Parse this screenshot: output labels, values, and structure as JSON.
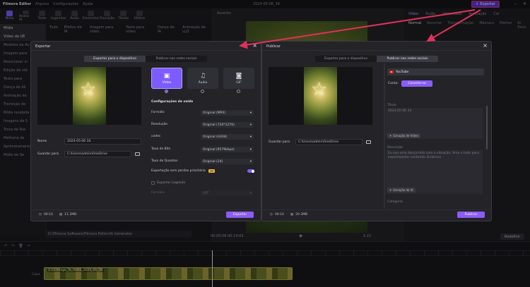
{
  "app": {
    "name": "Filmora Editor",
    "menus": [
      "Arquivo",
      "Configurações",
      "Ajuda"
    ],
    "doc_title": "2024-05-06_34",
    "export_button": "Exportar"
  },
  "toolbar": {
    "tools": [
      "Mídia",
      "Avatar AI",
      "Texto",
      "Legendas",
      "Áudio",
      "Elementos",
      "Transição",
      "Títulos",
      "Efeitos"
    ]
  },
  "left_panel": {
    "items": [
      "Mídia",
      "Vídeo da UE",
      "Modelos da Au",
      "Imagem para",
      "Reescrever vi",
      "Edição de vid",
      "Texto para",
      "Dança de Ali",
      "Animação de",
      "Transição de",
      "Mídia recebida",
      "Imagens de S",
      "Troca de Ros",
      "Melhoria de",
      "Aprimoramento",
      "Mídia de Se"
    ]
  },
  "media_tabs": [
    "Tudo",
    "Efeitos de IA",
    "Imagem para vídeo",
    "Texto para vídeo",
    "Dança de IA",
    "Animação de LLD"
  ],
  "preview": {
    "header": "Assento",
    "time_current": "00:00:08",
    "time_total": "00:14:03",
    "quality": "0.15"
  },
  "right_panel": {
    "tabs": [
      "Vídeo",
      "Áudio",
      "Velocidade",
      "Animação",
      "Cor"
    ],
    "subtabs": [
      "Normal",
      "Recortar",
      "Transformação",
      "Máscara",
      "Efeitos",
      "AI Tools"
    ],
    "reset": "Redefinir"
  },
  "timeline": {
    "clip_label": "1:14 Image_To_Video_2024_06_34",
    "track_label": "Capa",
    "path_text": "D:\\Filmora Software\\Filmora Editor\\AI Generator"
  },
  "export_dialog": {
    "title": "Exportar",
    "seg_device": "Exportar para o dispositivo",
    "seg_social": "Publicar nas redes sociais",
    "formats": [
      {
        "label": "Vídeo",
        "icon": "video-icon"
      },
      {
        "label": "Áudio",
        "icon": "music-icon"
      },
      {
        "label": "GIF",
        "icon": "gif-icon"
      }
    ],
    "name_label": "Nome",
    "name_value": "2024-05-06 34",
    "save_label": "Guardar para",
    "save_value": "C:\\Users\\admin\\OneDrive",
    "settings_title": "Configurações de saída",
    "rows": [
      {
        "label": "Formato",
        "value": "Original (MP4)"
      },
      {
        "label": "Resolução",
        "value": "Original (720*1276)"
      },
      {
        "label": "codec",
        "value": "Original (H264)"
      },
      {
        "label": "Taxa de Bits",
        "value": "Original (6579kbps)"
      },
      {
        "label": "Taxa de Quadros",
        "value": "Original (24)"
      }
    ],
    "lossless_label": "Exportação sem perdas prioritária",
    "vip_badge": "VIP",
    "subtitle_label": "Exportar Legenda",
    "subtitle_format_label": "Formato",
    "subtitle_format_value": "SRT",
    "duration": "00:14",
    "filesize": "11.2MB",
    "export_button": "Exportar"
  },
  "publish_dialog": {
    "title": "Publicar",
    "seg_device": "Exportar para o dispositivo",
    "seg_social": "Publicar nas redes sociais",
    "platform": "YouTube",
    "account_label": "Conta:",
    "connect_button": "Conecte-se",
    "title_label": "Título",
    "title_value": "2024-05-06 34",
    "desc_label": "Descrição",
    "desc_placeholder": "Eu sou uma dança feliz com a vibração. Ama o tudo para experimentar conteúdo dinâmico",
    "generate_btn": "Geração de Vídeo",
    "generate_btn2": "Geração de IA",
    "category_label": "Categoria",
    "save_label": "Guardar para",
    "save_value": "C:\\Users\\admin\\OneDrive",
    "duration": "00:14",
    "filesize": "20.3MB",
    "publish_button": "Publicar"
  },
  "colors": {
    "accent": "#8b5cf6",
    "accent_light": "#a98dff",
    "arrow": "#e0315b",
    "dialog_bg": "#232328"
  }
}
